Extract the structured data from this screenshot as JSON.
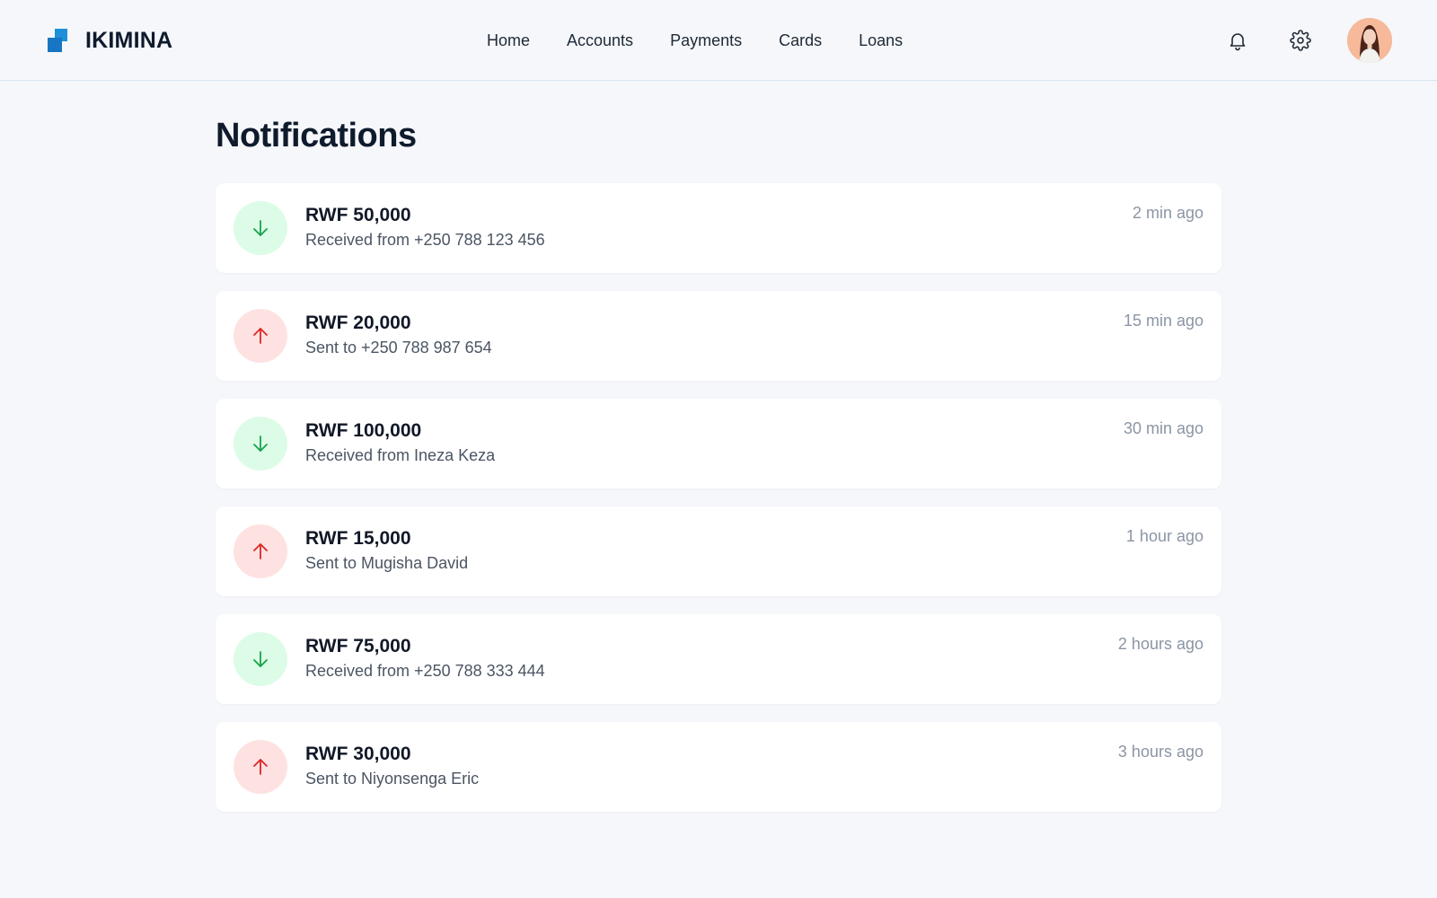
{
  "app": {
    "name": "IKIMINA"
  },
  "nav": {
    "items": [
      {
        "label": "Home"
      },
      {
        "label": "Accounts"
      },
      {
        "label": "Payments"
      },
      {
        "label": "Cards"
      },
      {
        "label": "Loans"
      }
    ]
  },
  "header": {
    "icons": [
      "bell-icon",
      "gear-icon"
    ],
    "avatar": "user-avatar"
  },
  "page": {
    "title": "Notifications"
  },
  "colors": {
    "brand": "#1f8fd8",
    "incoming": "#16a34a",
    "incoming_bg": "#dcfce7",
    "outgoing": "#dc2626",
    "outgoing_bg": "#fee2e2"
  },
  "notifications": [
    {
      "direction": "in",
      "icon": "arrow-down-icon",
      "amount": "RWF 50,000",
      "description": "Received from +250 788 123 456",
      "time": "2 min ago"
    },
    {
      "direction": "out",
      "icon": "arrow-up-icon",
      "amount": "RWF 20,000",
      "description": "Sent to +250 788 987 654",
      "time": "15 min ago"
    },
    {
      "direction": "in",
      "icon": "arrow-down-icon",
      "amount": "RWF 100,000",
      "description": "Received from Ineza Keza",
      "time": "30 min ago"
    },
    {
      "direction": "out",
      "icon": "arrow-up-icon",
      "amount": "RWF 15,000",
      "description": "Sent to Mugisha David",
      "time": "1 hour ago"
    },
    {
      "direction": "in",
      "icon": "arrow-down-icon",
      "amount": "RWF 75,000",
      "description": "Received from +250 788 333 444",
      "time": "2 hours ago"
    },
    {
      "direction": "out",
      "icon": "arrow-up-icon",
      "amount": "RWF 30,000",
      "description": "Sent to Niyonsenga Eric",
      "time": "3 hours ago"
    }
  ]
}
